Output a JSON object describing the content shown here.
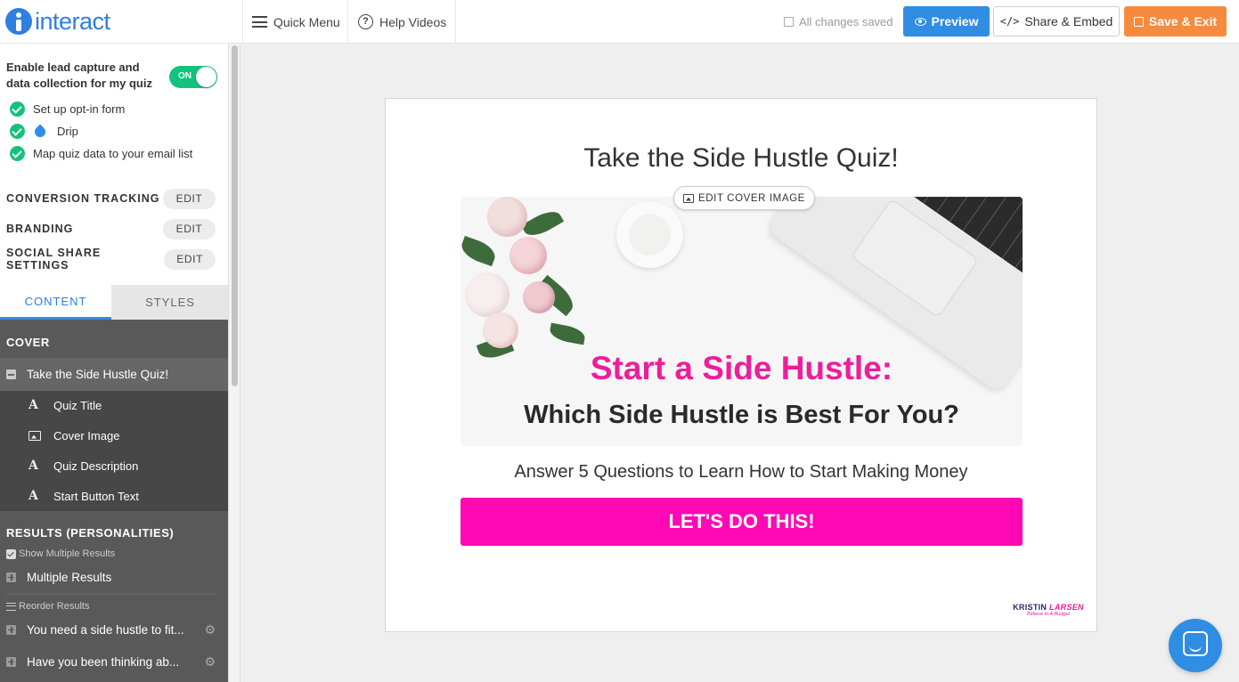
{
  "app": {
    "logo_text": "interact",
    "brand_color": "#2f7fe0"
  },
  "topbar": {
    "quick_menu": "Quick Menu",
    "help_videos": "Help Videos",
    "saved_status": "All changes saved",
    "preview": "Preview",
    "share": "Share & Embed",
    "save_exit": "Save & Exit"
  },
  "sidebar": {
    "lead_capture": "Enable lead capture and data collection for my quiz",
    "toggle_state": "ON",
    "checklist": [
      "Set up opt-in form",
      "Drip",
      "Map quiz data to your email list"
    ],
    "settings": [
      {
        "label": "CONVERSION TRACKING",
        "action": "EDIT"
      },
      {
        "label": "BRANDING",
        "action": "EDIT"
      },
      {
        "label": "SOCIAL SHARE SETTINGS",
        "action": "EDIT"
      }
    ],
    "tabs": [
      "CONTENT",
      "STYLES"
    ],
    "cover_heading": "COVER",
    "cover_item": "Take the Side Hustle Quiz!",
    "cover_subitems": [
      "Quiz Title",
      "Cover Image",
      "Quiz Description",
      "Start Button Text"
    ],
    "results_heading": "RESULTS (PERSONALITIES)",
    "show_multiple": "Show Multiple Results",
    "multiple_results": "Multiple Results",
    "reorder": "Reorder Results",
    "results": [
      "You need a side hustle to fit...",
      "Have you been thinking ab..."
    ]
  },
  "quiz": {
    "title": "Take the Side Hustle Quiz!",
    "edit_cover": "EDIT COVER IMAGE",
    "cover_headline": "Start a Side Hustle:",
    "cover_subheadline": "Which Side Hustle is Best For You?",
    "description": "Answer 5 Questions to Learn How to Start Making Money",
    "start_button": "LET'S DO THIS!",
    "brand_first": "KRISTIN",
    "brand_last": "LARSEN",
    "brand_tagline": "Believe In A Budget",
    "cta_color": "#ff08b5"
  }
}
